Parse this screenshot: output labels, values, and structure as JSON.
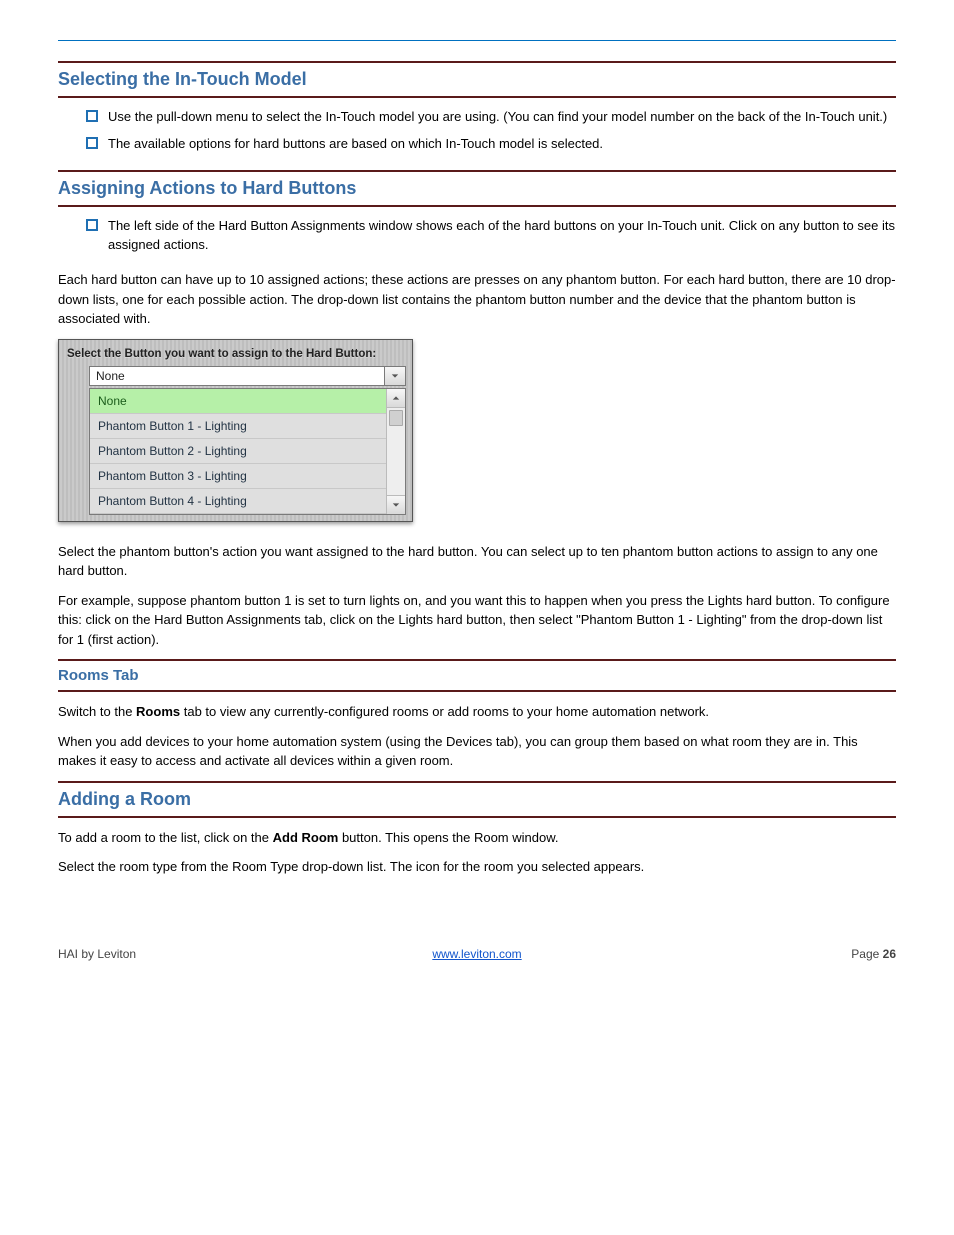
{
  "rules": {
    "top_color": "#0070c0",
    "section_color": "#5a1a1a"
  },
  "section_in_touch": {
    "title": "Selecting the In-Touch Model",
    "bullets": [
      "Use the pull-down menu to select the In-Touch model you are using.  (You can find your model number on the back of the In-Touch unit.)",
      "The available options for hard buttons are based on which In-Touch model is selected."
    ]
  },
  "section_assign": {
    "title": "Assigning Actions to Hard Buttons",
    "bullets": [
      "The left side of the Hard Button Assignments window shows each of the hard buttons on your In-Touch unit.  Click on any button to see its assigned actions."
    ],
    "p1": "Each hard button can have up to 10 assigned actions; these actions are presses on any phantom button.  For each hard button, there are 10 drop-down lists, one for each possible action.  The drop-down list contains the phantom button number and the device that the phantom button is associated with.",
    "p_after": "Select the phantom button's action you want assigned to the hard button.  You can select up to ten phantom button actions to assign to any one hard button.",
    "p_example": "For example, suppose phantom button 1 is set to turn lights on, and you want this to happen when you press the Lights hard button.  To configure this:  click on the Hard Button Assignments tab, click on the Lights hard button, then select \"Phantom Button 1 - Lighting\" from the drop-down list for 1 (first action)."
  },
  "section_rooms": {
    "title": "Rooms Tab",
    "p1_prefix": "Switch to the ",
    "p1_bold": "Rooms",
    "p1_suffix": " tab to view any currently-configured rooms or add rooms to your home automation network.",
    "p2": "When you add devices to your home automation system (using the Devices tab), you can group them based on what room they are in.  This makes it easy to access and activate all devices within a given room."
  },
  "section_add_room": {
    "title": "Adding a Room",
    "p1_prefix": "To add a room to the list, click on the ",
    "p1_bold": "Add Room",
    "p1_suffix": " button.  This opens the Room window.",
    "p2": "Select the room type from the Room Type drop-down list.  The icon for the room you selected appears."
  },
  "screenshot": {
    "label": "Select the Button you want to assign to the Hard Button:",
    "current": "None",
    "options": [
      "None",
      "Phantom Button 1 - Lighting",
      "Phantom Button 2 - Lighting",
      "Phantom Button 3 - Lighting",
      "Phantom Button 4 - Lighting"
    ],
    "selected_index": 0
  },
  "footer": {
    "left": "HAI by Leviton",
    "center_link": "www.leviton.com",
    "right_prefix": "Page ",
    "right_page": "26"
  }
}
